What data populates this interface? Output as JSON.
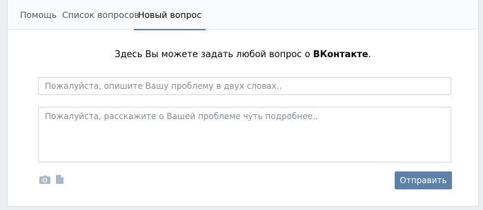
{
  "tabs": [
    {
      "label": "Помощь"
    },
    {
      "label": "Список вопросов"
    },
    {
      "label": "Новый вопрос",
      "active": true
    }
  ],
  "lead": {
    "prefix": "Здесь Вы можете задать любой вопрос о ",
    "brand": "ВКонтакте",
    "suffix": "."
  },
  "form": {
    "title_placeholder": "Пожалуйста, опишите Вашу проблему в двух словах..",
    "title_value": "",
    "body_placeholder": "Пожалуйста, расскажите о Вашей проблеме чуть подробнее..",
    "body_value": "",
    "attach_icons": [
      "camera-icon",
      "document-icon"
    ],
    "submit_label": "Отправить"
  },
  "colors": {
    "accent": "#5181b8",
    "button": "#5e81a8",
    "page_bg": "#edeef0",
    "icon": "#a7b7c8"
  }
}
